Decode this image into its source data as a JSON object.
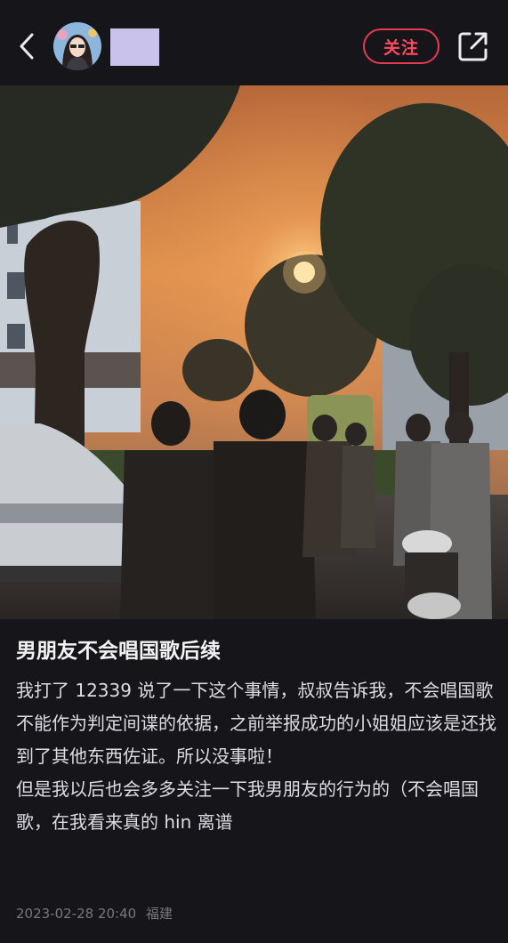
{
  "header": {
    "follow_label": "关注",
    "icons": {
      "back": "chevron-left-icon",
      "share": "share-icon"
    }
  },
  "post": {
    "title": "男朋友不会唱国歌后续",
    "body": "我打了 12339 说了一下这个事情，叔叔告诉我，不会唱国歌不能作为判定间谍的依据，之前举报成功的小姐姐应该是还找到了其他东西佐证。所以没事啦！\n但是我以后也会多多关注一下我男朋友的行为的（不会唱国歌，在我看来真的 hin 离谱",
    "date": "2023-02-28 20:40",
    "location": "福建"
  },
  "colors": {
    "background": "#16161a",
    "accent": "#e33b4f",
    "text": "#e9e9ee",
    "meta": "#77777f"
  }
}
